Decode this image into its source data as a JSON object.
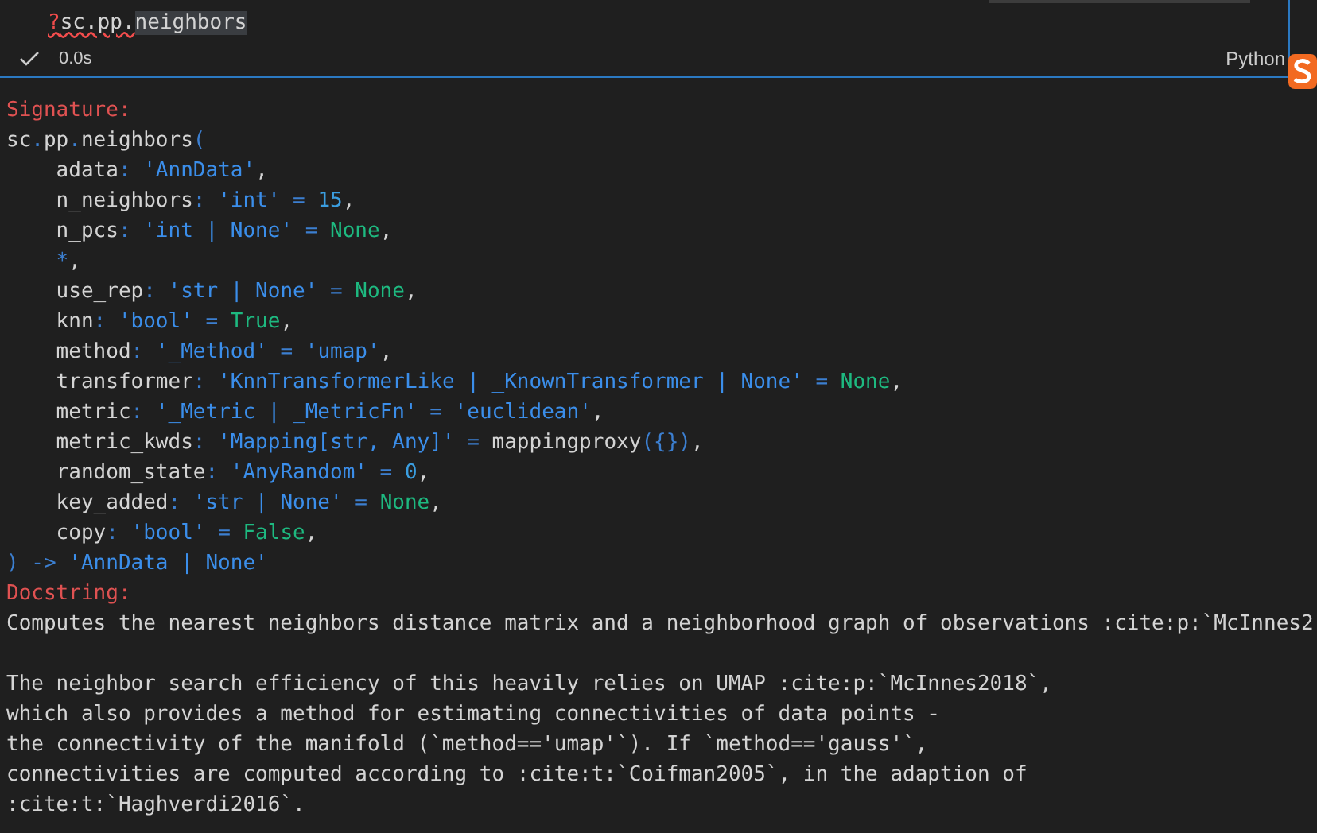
{
  "cell": {
    "input": [
      {
        "text": "?",
        "kind": "operator"
      },
      {
        "text": "sc.pp.",
        "kind": "plain"
      },
      {
        "text": "neighbors",
        "kind": "highlight"
      }
    ],
    "status": {
      "succeeded": true,
      "duration": "0.0s",
      "language": "Python"
    }
  },
  "output": {
    "signature_heading": "Signature:",
    "signature": [
      [
        {
          "text": "sc",
          "kind": "plain"
        },
        {
          "text": ".",
          "kind": "punct"
        },
        {
          "text": "pp",
          "kind": "plain"
        },
        {
          "text": ".",
          "kind": "punct"
        },
        {
          "text": "neighbors",
          "kind": "plain"
        },
        {
          "text": "(",
          "kind": "punct"
        }
      ],
      [
        {
          "text": "    adata",
          "kind": "plain"
        },
        {
          "text": ": ",
          "kind": "punct"
        },
        {
          "text": "'AnnData'",
          "kind": "string"
        },
        {
          "text": ",",
          "kind": "plain"
        }
      ],
      [
        {
          "text": "    n_neighbors",
          "kind": "plain"
        },
        {
          "text": ": ",
          "kind": "punct"
        },
        {
          "text": "'int'",
          "kind": "string"
        },
        {
          "text": " = ",
          "kind": "punct"
        },
        {
          "text": "15",
          "kind": "number"
        },
        {
          "text": ",",
          "kind": "plain"
        }
      ],
      [
        {
          "text": "    n_pcs",
          "kind": "plain"
        },
        {
          "text": ": ",
          "kind": "punct"
        },
        {
          "text": "'int | None'",
          "kind": "string"
        },
        {
          "text": " = ",
          "kind": "punct"
        },
        {
          "text": "None",
          "kind": "constant"
        },
        {
          "text": ",",
          "kind": "plain"
        }
      ],
      [
        {
          "text": "    *",
          "kind": "punct"
        },
        {
          "text": ",",
          "kind": "plain"
        }
      ],
      [
        {
          "text": "    use_rep",
          "kind": "plain"
        },
        {
          "text": ": ",
          "kind": "punct"
        },
        {
          "text": "'str | None'",
          "kind": "string"
        },
        {
          "text": " = ",
          "kind": "punct"
        },
        {
          "text": "None",
          "kind": "constant"
        },
        {
          "text": ",",
          "kind": "plain"
        }
      ],
      [
        {
          "text": "    knn",
          "kind": "plain"
        },
        {
          "text": ": ",
          "kind": "punct"
        },
        {
          "text": "'bool'",
          "kind": "string"
        },
        {
          "text": " = ",
          "kind": "punct"
        },
        {
          "text": "True",
          "kind": "constant"
        },
        {
          "text": ",",
          "kind": "plain"
        }
      ],
      [
        {
          "text": "    method",
          "kind": "plain"
        },
        {
          "text": ": ",
          "kind": "punct"
        },
        {
          "text": "'_Method'",
          "kind": "string"
        },
        {
          "text": " = ",
          "kind": "punct"
        },
        {
          "text": "'umap'",
          "kind": "string"
        },
        {
          "text": ",",
          "kind": "plain"
        }
      ],
      [
        {
          "text": "    transformer",
          "kind": "plain"
        },
        {
          "text": ": ",
          "kind": "punct"
        },
        {
          "text": "'KnnTransformerLike | _KnownTransformer | None'",
          "kind": "string"
        },
        {
          "text": " = ",
          "kind": "punct"
        },
        {
          "text": "None",
          "kind": "constant"
        },
        {
          "text": ",",
          "kind": "plain"
        }
      ],
      [
        {
          "text": "    metric",
          "kind": "plain"
        },
        {
          "text": ": ",
          "kind": "punct"
        },
        {
          "text": "'_Metric | _MetricFn'",
          "kind": "string"
        },
        {
          "text": " = ",
          "kind": "punct"
        },
        {
          "text": "'euclidean'",
          "kind": "string"
        },
        {
          "text": ",",
          "kind": "plain"
        }
      ],
      [
        {
          "text": "    metric_kwds",
          "kind": "plain"
        },
        {
          "text": ": ",
          "kind": "punct"
        },
        {
          "text": "'Mapping[str, Any]'",
          "kind": "string"
        },
        {
          "text": " = ",
          "kind": "punct"
        },
        {
          "text": "mappingproxy",
          "kind": "plain"
        },
        {
          "text": "({})",
          "kind": "punct"
        },
        {
          "text": ",",
          "kind": "plain"
        }
      ],
      [
        {
          "text": "    random_state",
          "kind": "plain"
        },
        {
          "text": ": ",
          "kind": "punct"
        },
        {
          "text": "'AnyRandom'",
          "kind": "string"
        },
        {
          "text": " = ",
          "kind": "punct"
        },
        {
          "text": "0",
          "kind": "number"
        },
        {
          "text": ",",
          "kind": "plain"
        }
      ],
      [
        {
          "text": "    key_added",
          "kind": "plain"
        },
        {
          "text": ": ",
          "kind": "punct"
        },
        {
          "text": "'str | None'",
          "kind": "string"
        },
        {
          "text": " = ",
          "kind": "punct"
        },
        {
          "text": "None",
          "kind": "constant"
        },
        {
          "text": ",",
          "kind": "plain"
        }
      ],
      [
        {
          "text": "    copy",
          "kind": "plain"
        },
        {
          "text": ": ",
          "kind": "punct"
        },
        {
          "text": "'bool'",
          "kind": "string"
        },
        {
          "text": " = ",
          "kind": "punct"
        },
        {
          "text": "False",
          "kind": "constant"
        },
        {
          "text": ",",
          "kind": "plain"
        }
      ],
      [
        {
          "text": ") -> ",
          "kind": "punct"
        },
        {
          "text": "'AnnData | None'",
          "kind": "string"
        }
      ]
    ],
    "docstring_heading": "Docstring:",
    "docstring": [
      [
        "Computes the nearest neighbors distance matrix and a neighborhood graph of observations :cite:p:`McInnes2"
      ],
      [
        "The neighbor search efficiency of this heavily relies on UMAP :cite:p:`McInnes2018`,",
        "which also provides a method for estimating connectivities of data points -",
        "the connectivity of the manifold (`method=='umap'`). If `method=='gauss'`,",
        "connectivities are computed according to :cite:t:`Coifman2005`, in the adaption of",
        ":cite:t:`Haghverdi2016`."
      ]
    ]
  }
}
